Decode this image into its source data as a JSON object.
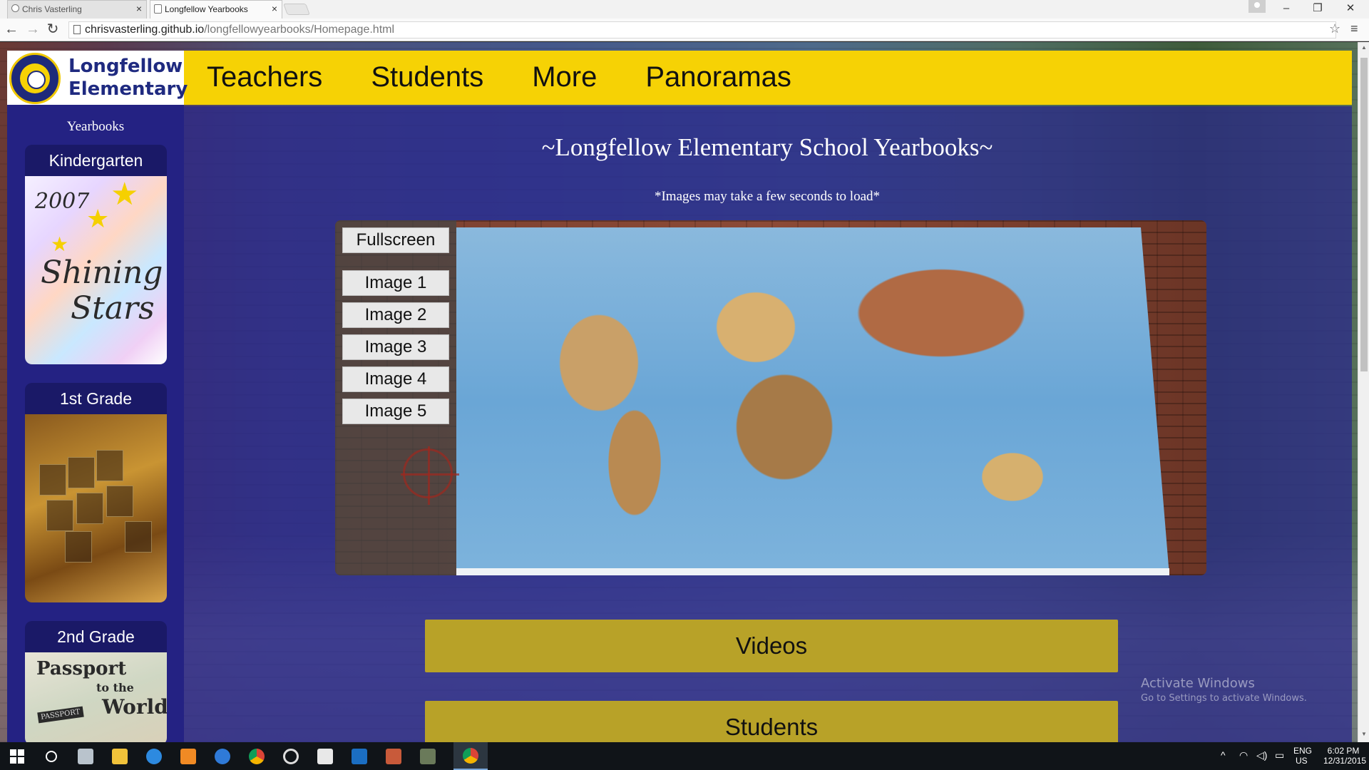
{
  "browser": {
    "tabs": [
      {
        "title": "Chris Vasterling",
        "active": false
      },
      {
        "title": "Longfellow Yearbooks",
        "active": true
      }
    ],
    "url_host": "chrisvasterling.github.io",
    "url_path": "/longfellowyearbooks/Homepage.html"
  },
  "header": {
    "logo_line1": "Longfellow",
    "logo_line2": "Elementary",
    "nav": [
      "Teachers",
      "Students",
      "More",
      "Panoramas"
    ]
  },
  "sidebar": {
    "title": "Yearbooks",
    "books": [
      {
        "label": "Kindergarten",
        "cover_text_1": "2007",
        "cover_text_2": "Shining",
        "cover_text_3": "Stars"
      },
      {
        "label": "1st Grade"
      },
      {
        "label": "2nd Grade",
        "cover_text_1": "Passport",
        "cover_text_2": "to the",
        "cover_text_3": "World",
        "cover_text_4": "PASSPORT"
      }
    ]
  },
  "main": {
    "heading": "~Longfellow Elementary School Yearbooks~",
    "note": "*Images may take a few seconds to load*",
    "gallery": {
      "fullscreen": "Fullscreen",
      "images": [
        "Image 1",
        "Image 2",
        "Image 3",
        "Image 4",
        "Image 5"
      ]
    },
    "sections": [
      "Videos",
      "Students"
    ]
  },
  "watermark": {
    "title": "Activate Windows",
    "subtitle": "Go to Settings to activate Windows."
  },
  "taskbar": {
    "language": "ENG",
    "region": "US",
    "time": "6:02 PM",
    "date": "12/31/2015"
  },
  "colors": {
    "header_yellow": "#f6d205",
    "sidebar_navy": "#242283",
    "section_gold": "#b8a228"
  }
}
